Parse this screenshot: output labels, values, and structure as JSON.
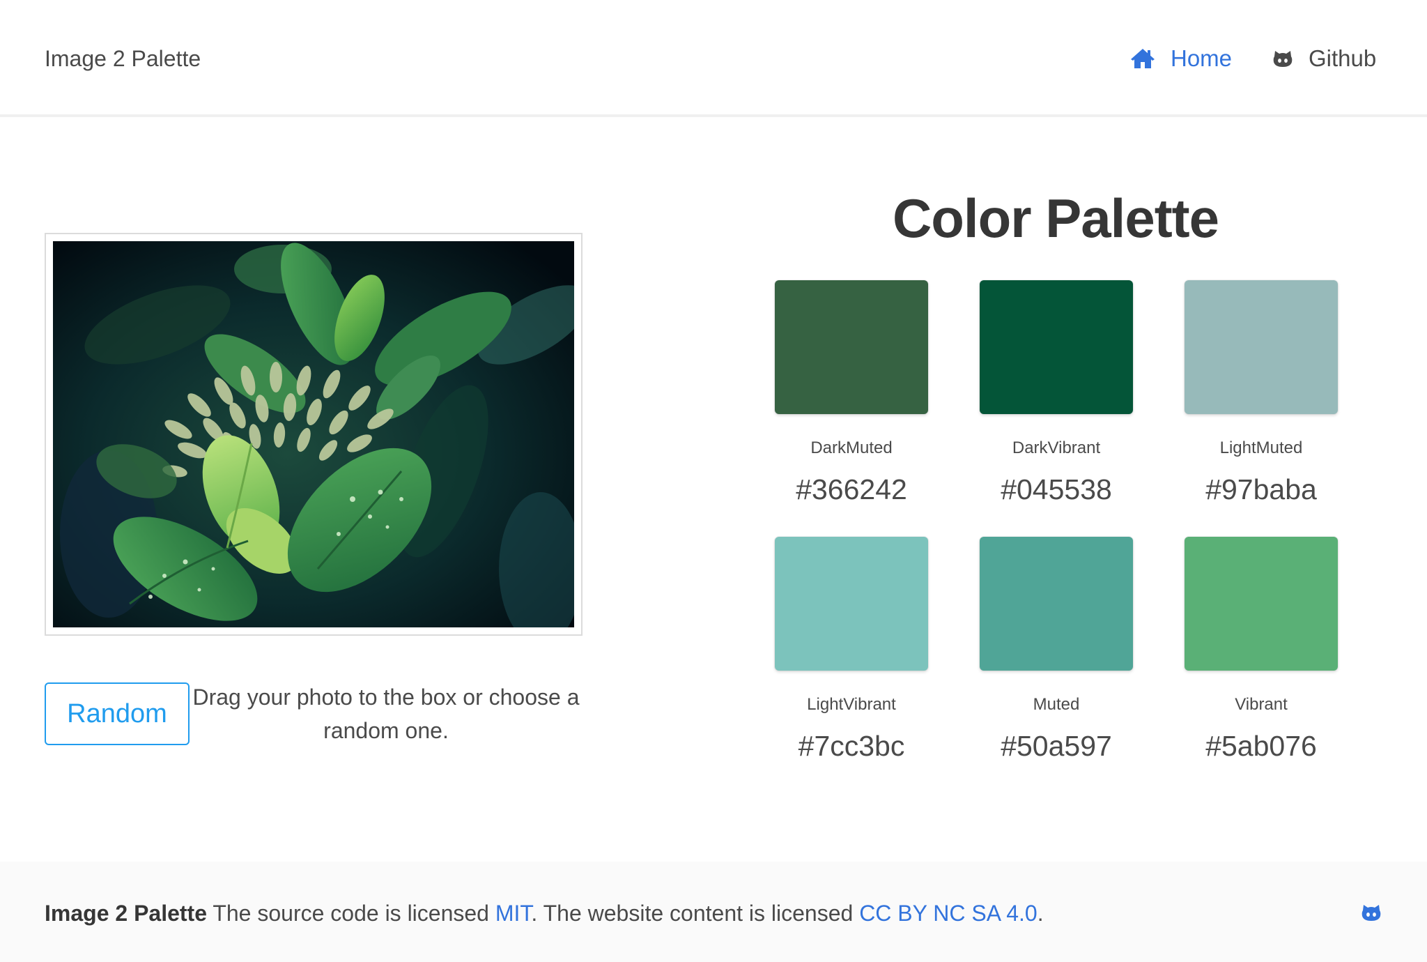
{
  "navbar": {
    "brand": "Image 2 Palette",
    "home_label": "Home",
    "github_label": "Github",
    "home_icon": "home-icon",
    "github_icon": "github-icon"
  },
  "upload": {
    "random_label": "Random",
    "hint": "Drag your photo to the box or choose a random one.",
    "image_subject": "green leaves with water droplets"
  },
  "palette": {
    "title": "Color Palette",
    "swatches": [
      {
        "name": "DarkMuted",
        "hex": "#366242"
      },
      {
        "name": "DarkVibrant",
        "hex": "#045538"
      },
      {
        "name": "LightMuted",
        "hex": "#97baba"
      },
      {
        "name": "LightVibrant",
        "hex": "#7cc3bc"
      },
      {
        "name": "Muted",
        "hex": "#50a597"
      },
      {
        "name": "Vibrant",
        "hex": "#5ab076"
      }
    ]
  },
  "footer": {
    "brand": "Image 2 Palette",
    "text_1": " The source code is licensed ",
    "mit_link": "MIT",
    "text_2": ". The website content is licensed ",
    "cc_link": "CC BY NC SA 4.0",
    "text_3": ".",
    "icon": "github-icon"
  },
  "colors": {
    "link": "#3273dc",
    "button": "#209cee",
    "text": "#4a4a4a"
  }
}
